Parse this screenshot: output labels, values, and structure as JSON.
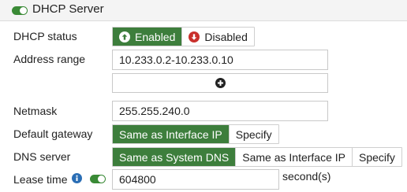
{
  "header": {
    "title": "DHCP Server",
    "toggle_on": true
  },
  "dhcp_status": {
    "label": "DHCP status",
    "options": [
      "Enabled",
      "Disabled"
    ],
    "selected": "Enabled",
    "icons": [
      "arrow-up-circle-icon",
      "arrow-down-circle-icon"
    ]
  },
  "address_range": {
    "label": "Address range",
    "value": "10.233.0.2-10.233.0.10"
  },
  "netmask": {
    "label": "Netmask",
    "value": "255.255.240.0"
  },
  "default_gateway": {
    "label": "Default gateway",
    "options": [
      "Same as Interface IP",
      "Specify"
    ],
    "selected": "Same as Interface IP"
  },
  "dns_server": {
    "label": "DNS server",
    "options": [
      "Same as System DNS",
      "Same as Interface IP",
      "Specify"
    ],
    "selected": "Same as System DNS"
  },
  "lease_time": {
    "label": "Lease time",
    "value": "604800",
    "unit": "second(s)",
    "toggle_on": true
  },
  "colors": {
    "active_green": "#3d7e3c",
    "toggle_green": "#3a8a36",
    "enabled_icon_green": "#3d7e3c",
    "disabled_icon_red": "#c9302c",
    "info_blue": "#2a6eb5"
  }
}
